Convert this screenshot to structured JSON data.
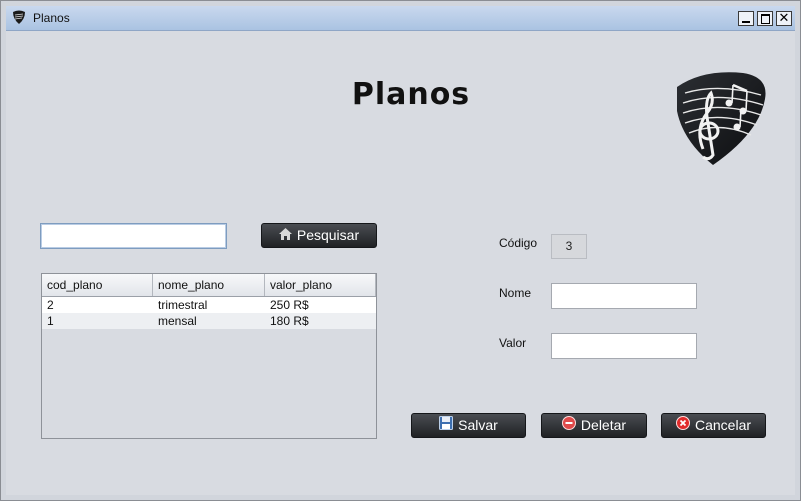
{
  "window": {
    "title": "Planos"
  },
  "header": {
    "heading": "Planos"
  },
  "search": {
    "value": "",
    "button_label": "Pesquisar"
  },
  "table": {
    "columns": [
      "cod_plano",
      "nome_plano",
      "valor_plano"
    ],
    "rows": [
      [
        "2",
        "trimestral",
        "250 R$"
      ],
      [
        "1",
        "mensal",
        "180 R$"
      ]
    ]
  },
  "form": {
    "codigo_label": "Código",
    "codigo_value": "3",
    "nome_label": "Nome",
    "nome_value": "",
    "valor_label": "Valor",
    "valor_value": ""
  },
  "actions": {
    "save_label": "Salvar",
    "delete_label": "Deletar",
    "cancel_label": "Cancelar"
  },
  "icons": {
    "window": "guitar-pick-icon",
    "logo": "guitar-pick-music-logo",
    "search": "home-icon",
    "save": "floppy-disk-icon",
    "delete": "minus-circle-icon",
    "cancel": "x-circle-icon"
  }
}
